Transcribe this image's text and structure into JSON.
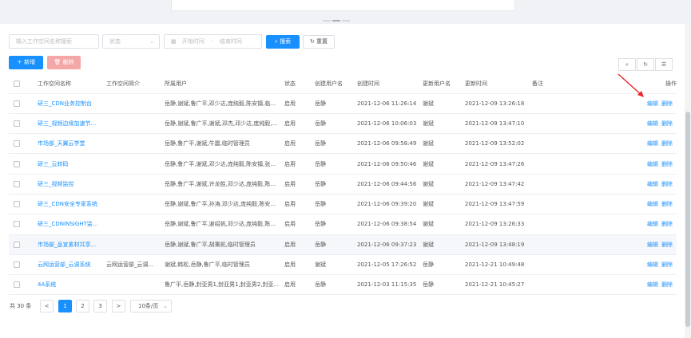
{
  "filters": {
    "search_placeholder": "输入工作空间名称搜索",
    "status_placeholder": "状态",
    "start_placeholder": "开始时间",
    "range_sep": "-",
    "end_placeholder": "结束时间",
    "search_label": "搜索",
    "reset_label": "重置"
  },
  "toolbar": {
    "add_label": "新增",
    "delete_label": "删除"
  },
  "table": {
    "columns": [
      "工作空间名称",
      "工作空间简介",
      "所属用户",
      "状态",
      "创建用户名",
      "创建时间",
      "更新用户名",
      "更新时间",
      "备注",
      "操作"
    ],
    "rows": [
      {
        "name": "研三_CDN业务控制台",
        "intro": "",
        "users": "岳静,谢斌,鲁广平,邓少达,庞纯毅,陈安镇,临...",
        "status": "启用",
        "creator": "岳静",
        "created": "2021-12-06 11:26:14",
        "updater": "谢斌",
        "updated": "2021-12-09 13:26:18",
        "remark": ""
      },
      {
        "name": "研三_视频边缘加速节...",
        "intro": "",
        "users": "岳静,谢斌,鲁广平,谢斌,邓杰,邓少达,庞纯毅,陈安...",
        "status": "启用",
        "creator": "岳静",
        "created": "2021-12-06 10:06:03",
        "updater": "谢斌",
        "updated": "2021-12-09 13:47:10",
        "remark": ""
      },
      {
        "name": "市场部_天翼云学堂",
        "intro": "",
        "users": "岳静,鲁广平,谢斌,牛震,临时管理员",
        "status": "启用",
        "creator": "岳静",
        "created": "2021-12-06 09:58:49",
        "updater": "谢斌",
        "updated": "2021-12-09 13:52:02",
        "remark": ""
      },
      {
        "name": "研三_云转码",
        "intro": "",
        "users": "岳静,鲁广平,谢斌,邓少达,庞纯毅,陈安镇,张...",
        "status": "启用",
        "creator": "岳静",
        "created": "2021-12-06 09:50:46",
        "updater": "谢斌",
        "updated": "2021-12-09 13:47:26",
        "remark": ""
      },
      {
        "name": "研三_视频监控",
        "intro": "",
        "users": "岳静,鲁广平,谢斌,许龙胜,邓少达,庞纯毅,陈...",
        "status": "启用",
        "creator": "岳静",
        "created": "2021-12-06 09:44:56",
        "updater": "谢斌",
        "updated": "2021-12-09 13:47:42",
        "remark": ""
      },
      {
        "name": "研三_CDN安全专家系统",
        "intro": "",
        "users": "岳静,谢斌,鲁广平,孙涛,邓少达,庞纯毅,陈安...",
        "status": "启用",
        "creator": "岳静",
        "created": "2021-12-06 09:39:20",
        "updater": "谢斌",
        "updated": "2021-12-09 13:47:59",
        "remark": ""
      },
      {
        "name": "研三_CDNINSIGHT监...",
        "intro": "",
        "users": "岳静,谢斌,鲁广平,谢绍帆,邓少达,庞纯毅,陈...",
        "status": "启用",
        "creator": "岳静",
        "created": "2021-12-06 09:38:54",
        "updater": "谢斌",
        "updated": "2021-12-09 13:26:33",
        "remark": ""
      },
      {
        "name": "市场部_品宣素材共享...",
        "intro": "",
        "users": "岳静,谢斌,鲁广平,胡秉凯,临时管理员",
        "status": "启用",
        "creator": "岳静",
        "created": "2021-12-06 09:37:23",
        "updater": "谢斌",
        "updated": "2021-12-09 13:48:19",
        "remark": ""
      },
      {
        "name": "云网运营部_云调系统",
        "intro": "云网运营部_云调...",
        "users": "谢斌,韩松,岳静,鲁广平,临时管理员",
        "status": "启用",
        "creator": "谢斌",
        "created": "2021-12-05 17:26:52",
        "updater": "岳静",
        "updated": "2021-12-21 10:49:48",
        "remark": ""
      },
      {
        "name": "4A系统",
        "intro": "",
        "users": "鲁广平,岳静,封亚男1,封亚男1,封亚男2,封亚...",
        "status": "启用",
        "creator": "岳静",
        "created": "2021-12-03 11:15:35",
        "updater": "岳静",
        "updated": "2021-12-21 10:45:27",
        "remark": ""
      }
    ],
    "edit_label": "编辑",
    "delete_label": "删除"
  },
  "pagination": {
    "total_text": "共 30 条",
    "prev": "<",
    "pages": [
      "1",
      "2",
      "3"
    ],
    "next": ">",
    "page_size": "10条/页"
  },
  "colors": {
    "primary": "#1890ff",
    "danger_light": "#f3a7a7",
    "annotation_arrow": "#e8252a"
  }
}
